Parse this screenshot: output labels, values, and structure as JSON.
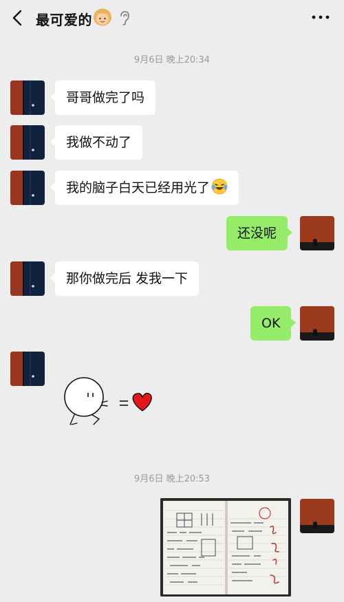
{
  "header": {
    "back_icon": "chevron-left-icon",
    "title": "最可爱的",
    "title_emoji": "girl-face-emoji",
    "ear_icon": "ear-icon",
    "more_icon": "more-dots-icon"
  },
  "colors": {
    "background": "#ededed",
    "incoming_bubble": "#ffffff",
    "outgoing_bubble": "#95ec69",
    "timestamp": "#9a9a9a"
  },
  "messages": {
    "ts1": "9月6日 晚上20:34",
    "m1": "哥哥做完了吗",
    "m2": "我做不动了",
    "m3": "我的脑子白天已经用光了",
    "m3_emoji": "laughing-tears-emoji",
    "m4": "还没呢",
    "m5": "那你做完后 发我一下",
    "m6": "OK",
    "m7_sticker": "running-to-heart-sticker",
    "ts2": "9月6日 晚上20:53",
    "m8_image": "homework-notebook-photo"
  }
}
